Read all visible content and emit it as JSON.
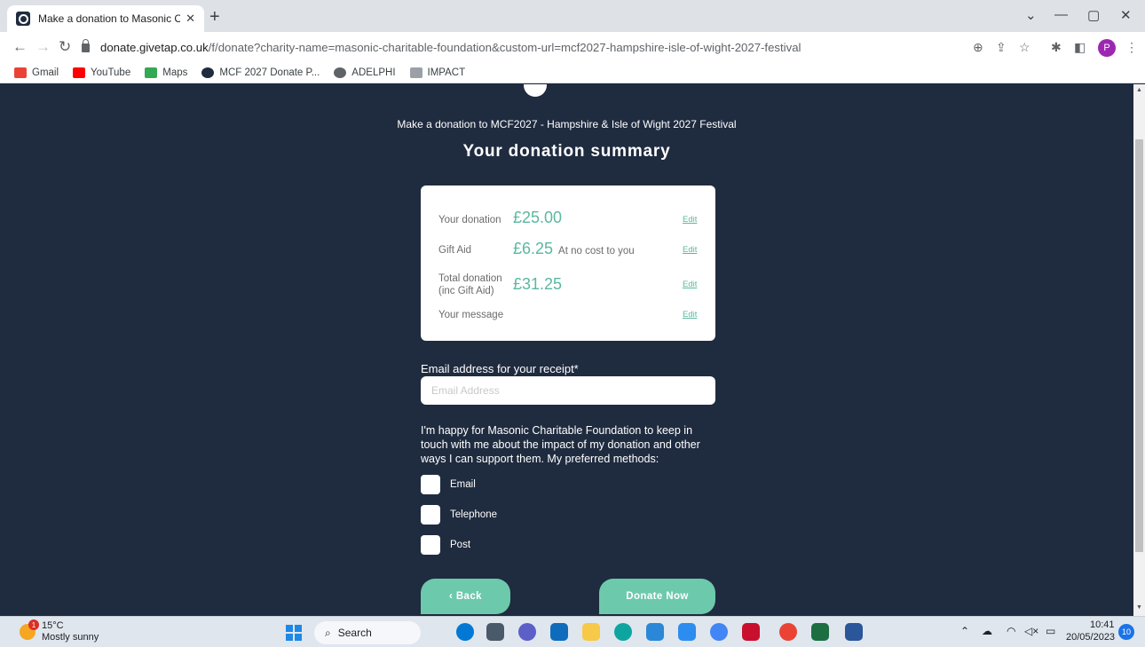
{
  "browser": {
    "tab_title": "Make a donation to Masonic Cha",
    "tab_close": "✕",
    "new_tab": "+",
    "url_domain": "donate.givetap.co.uk",
    "url_path": "/f/donate?charity-name=masonic-charitable-foundation&custom-url=mcf2027-hampshire-isle-of-wight-2027-festival",
    "profile_initial": "P",
    "bookmarks": [
      "Gmail",
      "YouTube",
      "Maps",
      "MCF 2027 Donate P...",
      "ADELPHI",
      "IMPACT"
    ]
  },
  "page": {
    "subtitle": "Make a donation to MCF2027 - Hampshire & Isle of Wight 2027 Festival",
    "heading": "Your donation summary",
    "summary": {
      "donation_label": "Your donation",
      "donation_amount": "£25.00",
      "gift_aid_label": "Gift Aid",
      "gift_aid_amount": "£6.25",
      "gift_aid_note": "At no cost to you",
      "total_label_line1": "Total donation",
      "total_label_line2": "(inc Gift Aid)",
      "total_amount": "£31.25",
      "message_label": "Your message",
      "edit_label": "Edit"
    },
    "email_label": "Email address for your receipt*",
    "email_placeholder": "Email Address",
    "email_value": "",
    "consent_text": "I'm happy for Masonic Charitable Foundation to keep in touch with me about the impact of my donation and other ways I can support them. My preferred methods:",
    "methods": [
      {
        "label": "Email",
        "checked": false
      },
      {
        "label": "Telephone",
        "checked": false
      },
      {
        "label": "Post",
        "checked": false
      }
    ],
    "back_label": "‹ Back",
    "donate_label": "Donate Now"
  },
  "taskbar": {
    "weather_temp": "15°C",
    "weather_desc": "Mostly sunny",
    "weather_badge": "1",
    "search_label": "Search",
    "time": "10:41",
    "date": "20/05/2023",
    "notification_count": "10"
  },
  "colors": {
    "page_bg": "#1f2b3f",
    "accent": "#6dc9ab",
    "amount": "#5ab8a0"
  }
}
